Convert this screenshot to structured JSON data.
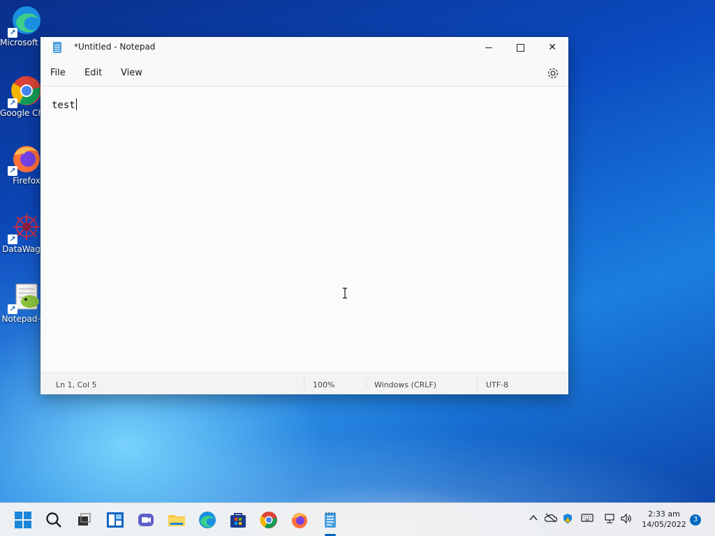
{
  "desktop": {
    "icons": [
      {
        "label": "Microsoft Edge",
        "icon": "edge-icon"
      },
      {
        "label": "Google Chrome",
        "icon": "chrome-icon"
      },
      {
        "label": "Firefox",
        "icon": "firefox-icon"
      },
      {
        "label": "DataWagon",
        "icon": "datawagon-icon"
      },
      {
        "label": "Notepad++",
        "icon": "notepadplusplus-icon"
      }
    ]
  },
  "window": {
    "title": "*Untitled - Notepad",
    "minimize": "minimize",
    "maximize": "maximize",
    "close": "✕",
    "menu": {
      "file": "File",
      "edit": "Edit",
      "view": "View"
    },
    "editor_text": "test",
    "status": {
      "position": "Ln 1, Col 5",
      "zoom": "100%",
      "line_ending": "Windows (CRLF)",
      "encoding": "UTF-8"
    }
  },
  "taskbar": {
    "apps": [
      "start-icon",
      "search-icon",
      "task-view-icon",
      "widgets-icon",
      "chat-icon",
      "file-explorer-icon",
      "edge-icon",
      "store-icon",
      "chrome-icon",
      "firefox-icon",
      "notepad-icon"
    ],
    "clock_time": "2:33 am",
    "clock_date": "14/05/2022",
    "notification_count": "3"
  },
  "colors": {
    "accent": "#0067c0",
    "window_bg": "#f9f9f9"
  }
}
